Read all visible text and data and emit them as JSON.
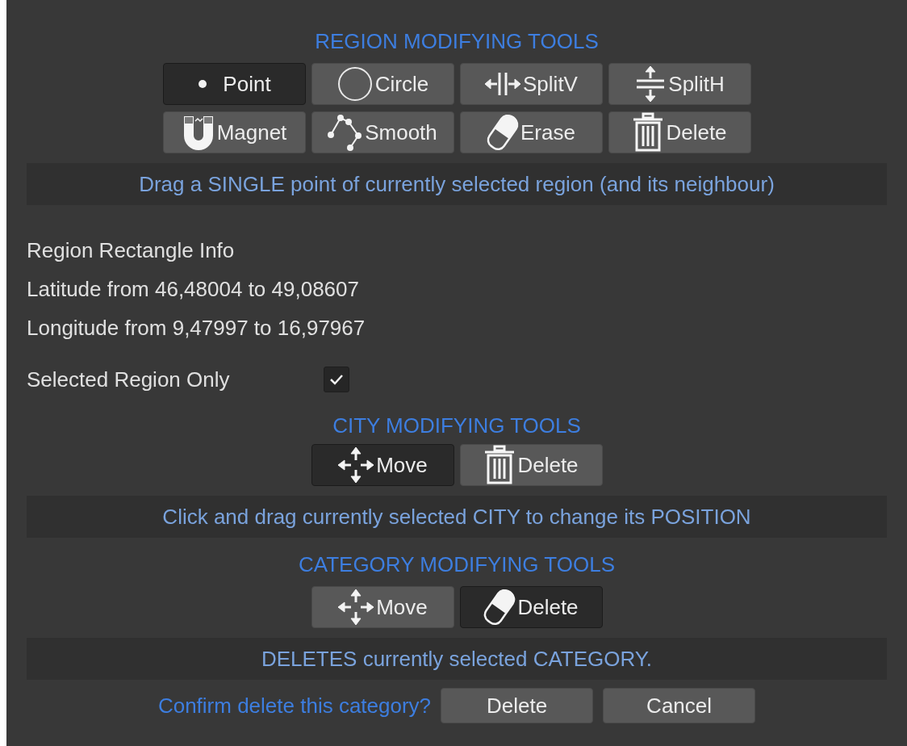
{
  "region_tools": {
    "heading": "REGION MODIFYING TOOLS",
    "tools": [
      {
        "label": "Point",
        "kind": "point",
        "selected": true
      },
      {
        "label": "Circle",
        "kind": "circle",
        "selected": false
      },
      {
        "label": "SplitV",
        "kind": "split_v",
        "selected": false
      },
      {
        "label": "SplitH",
        "kind": "split_h",
        "selected": false
      },
      {
        "label": "Magnet",
        "kind": "magnet",
        "selected": false
      },
      {
        "label": "Smooth",
        "kind": "smooth",
        "selected": false
      },
      {
        "label": "Erase",
        "kind": "erase",
        "selected": false
      },
      {
        "label": "Delete",
        "kind": "trash",
        "selected": false
      }
    ],
    "hint": "Drag a SINGLE point of currently selected region (and its neighbour)"
  },
  "region_rectangle_info": {
    "title": "Region Rectangle Info",
    "latitude": "Latitude from 46,48004 to 49,08607",
    "longitude": "Longitude from 9,47997 to 16,97967",
    "selected_region_only": {
      "label": "Selected Region Only",
      "checked": true
    }
  },
  "city_tools": {
    "heading": "CITY MODIFYING TOOLS",
    "tools": [
      {
        "label": "Move",
        "kind": "move",
        "selected": true
      },
      {
        "label": "Delete",
        "kind": "trash",
        "selected": false
      }
    ],
    "hint": "Click and drag currently selected CITY to change its POSITION"
  },
  "category_tools": {
    "heading": "CATEGORY MODIFYING TOOLS",
    "tools": [
      {
        "label": "Move",
        "kind": "move",
        "selected": false
      },
      {
        "label": "Delete",
        "kind": "erase",
        "selected": true
      }
    ],
    "hint": "DELETES currently selected CATEGORY.",
    "confirm": {
      "prompt": "Confirm delete this category?",
      "buttons": [
        "Delete",
        "Cancel"
      ]
    }
  }
}
